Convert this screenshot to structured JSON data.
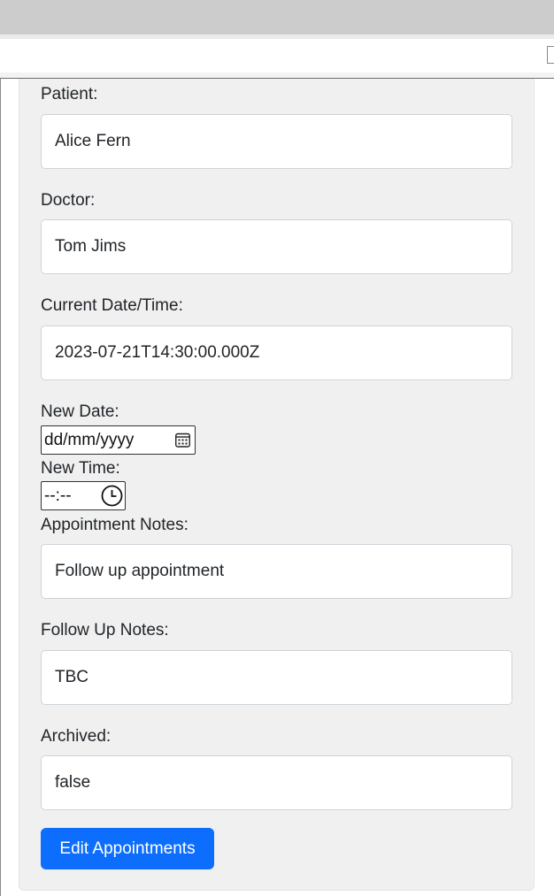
{
  "form": {
    "patient": {
      "label": "Patient:",
      "value": "Alice Fern"
    },
    "doctor": {
      "label": "Doctor:",
      "value": "Tom Jims"
    },
    "current_datetime": {
      "label": "Current Date/Time:",
      "value": "2023-07-21T14:30:00.000Z"
    },
    "new_date": {
      "label": "New Date:",
      "placeholder": "dd/mm/yyyy",
      "icon": "calendar-icon"
    },
    "new_time": {
      "label": "New Time:",
      "placeholder": "--:--",
      "icon": "clock-icon"
    },
    "appointment_notes": {
      "label": "Appointment Notes:",
      "value": "Follow up appointment"
    },
    "follow_up_notes": {
      "label": "Follow Up Notes:",
      "value": "TBC"
    },
    "archived": {
      "label": "Archived:",
      "value": "false"
    },
    "submit_label": "Edit Appointments"
  },
  "colors": {
    "primary_button": "#0d6efd",
    "card_background": "#f0f0f0",
    "field_border": "#ced4da"
  }
}
